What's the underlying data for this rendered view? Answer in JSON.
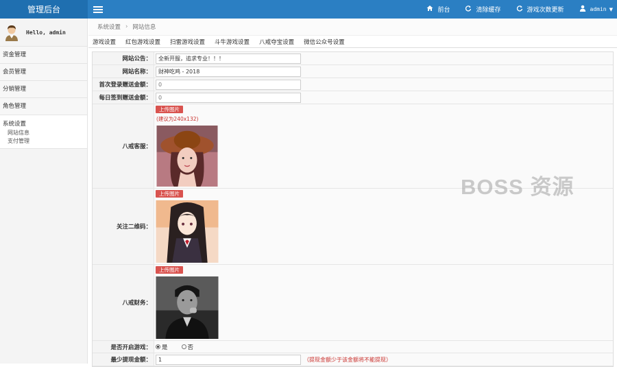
{
  "app": {
    "brand": "管理后台"
  },
  "topnav": [
    {
      "label": "前台",
      "icon": "home-icon"
    },
    {
      "label": "清除缓存",
      "icon": "refresh-icon"
    },
    {
      "label": "游戏次数更新",
      "icon": "refresh-icon"
    },
    {
      "label": "admin",
      "icon": "user-icon"
    }
  ],
  "user": {
    "greeting": "Hello, admin"
  },
  "sidebar": {
    "items": [
      "资金管理",
      "会员管理",
      "分销管理",
      "角色管理"
    ],
    "group": {
      "title": "系统设置",
      "subitems": [
        "网站信息",
        "支付管理"
      ]
    }
  },
  "breadcrumb": {
    "root": "系统设置",
    "current": "网站信息"
  },
  "tabs": [
    "游戏设置",
    "红包游戏设置",
    "扫雷游戏设置",
    "斗牛游戏设置",
    "八戒夺宝设置",
    "微信公众号设置"
  ],
  "form": {
    "notice": {
      "label": "网站公告：",
      "value": "全新开服，追求专业！！！"
    },
    "site_name": {
      "label": "网站名称：",
      "value": "财神吃鸡 - 2018"
    },
    "first_login_bonus": {
      "label": "首次登录赠送金额：",
      "value": "0"
    },
    "daily_checkin_bonus": {
      "label": "每日签到赠送金额：",
      "value": "0"
    },
    "upload_label": "上传图片",
    "size_hint": "(建议为240x132)",
    "service": {
      "label": "八戒客服："
    },
    "qrcode": {
      "label": "关注二维码："
    },
    "finance": {
      "label": "八戒财务："
    },
    "game_enabled": {
      "label": "是否开启游戏：",
      "yes": "是",
      "no": "否",
      "selected": "是"
    },
    "min_withdraw": {
      "label": "最少提现金额：",
      "value": "1",
      "warning": "（提现金额少于该金额将不能提现）"
    }
  },
  "watermark": "BOSS 资源",
  "colors": {
    "topbar": "#2b7fc3",
    "brand_bg": "#1f6fb0",
    "upload_btn": "#d9534f",
    "warning": "#c9302c"
  }
}
